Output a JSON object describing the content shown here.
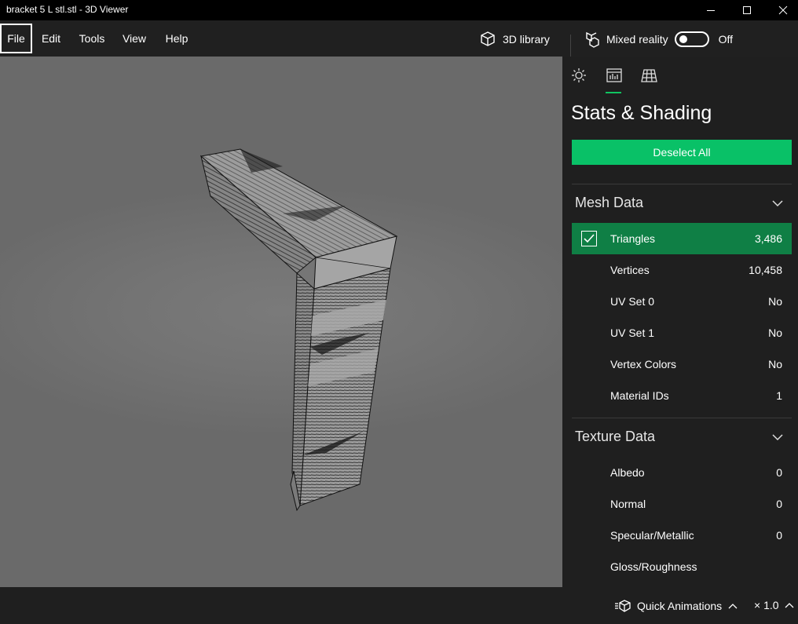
{
  "window": {
    "title": "bracket 5 L stl.stl - 3D Viewer",
    "controls": {
      "minimize_icon": "minimize-icon",
      "maximize_icon": "maximize-icon",
      "close_icon": "close-icon"
    }
  },
  "menu": {
    "items": [
      "File",
      "Edit",
      "Tools",
      "View",
      "Help"
    ],
    "active": "File"
  },
  "toolbar": {
    "library_label": "3D library",
    "library_icon": "cube-icon",
    "mixed_reality_label": "Mixed reality",
    "mixed_reality_icon": "mixed-reality-icon",
    "mixed_reality_state": "Off"
  },
  "panel": {
    "tabs": [
      {
        "icon": "sun-icon",
        "name": "lighting"
      },
      {
        "icon": "stats-icon",
        "name": "stats-shading",
        "active": true
      },
      {
        "icon": "grid-icon",
        "name": "grid"
      }
    ],
    "title": "Stats & Shading",
    "deselect_label": "Deselect All",
    "mesh_section": {
      "title": "Mesh Data",
      "rows": [
        {
          "label": "Triangles",
          "value": "3,486",
          "checked": true
        },
        {
          "label": "Vertices",
          "value": "10,458"
        },
        {
          "label": "UV Set 0",
          "value": "No"
        },
        {
          "label": "UV Set 1",
          "value": "No"
        },
        {
          "label": "Vertex Colors",
          "value": "No"
        },
        {
          "label": "Material IDs",
          "value": "1"
        }
      ]
    },
    "texture_section": {
      "title": "Texture Data",
      "rows": [
        {
          "label": "Albedo",
          "value": "0"
        },
        {
          "label": "Normal",
          "value": "0"
        },
        {
          "label": "Specular/Metallic",
          "value": "0"
        },
        {
          "label": "Gloss/Roughness",
          "value": ""
        }
      ]
    }
  },
  "bottom": {
    "quick_animations_label": "Quick Animations",
    "speed_label": "× 1.0"
  },
  "colors": {
    "accent": "#09c167",
    "selected_row": "#0f7f45",
    "viewport_bg": "#747474"
  }
}
